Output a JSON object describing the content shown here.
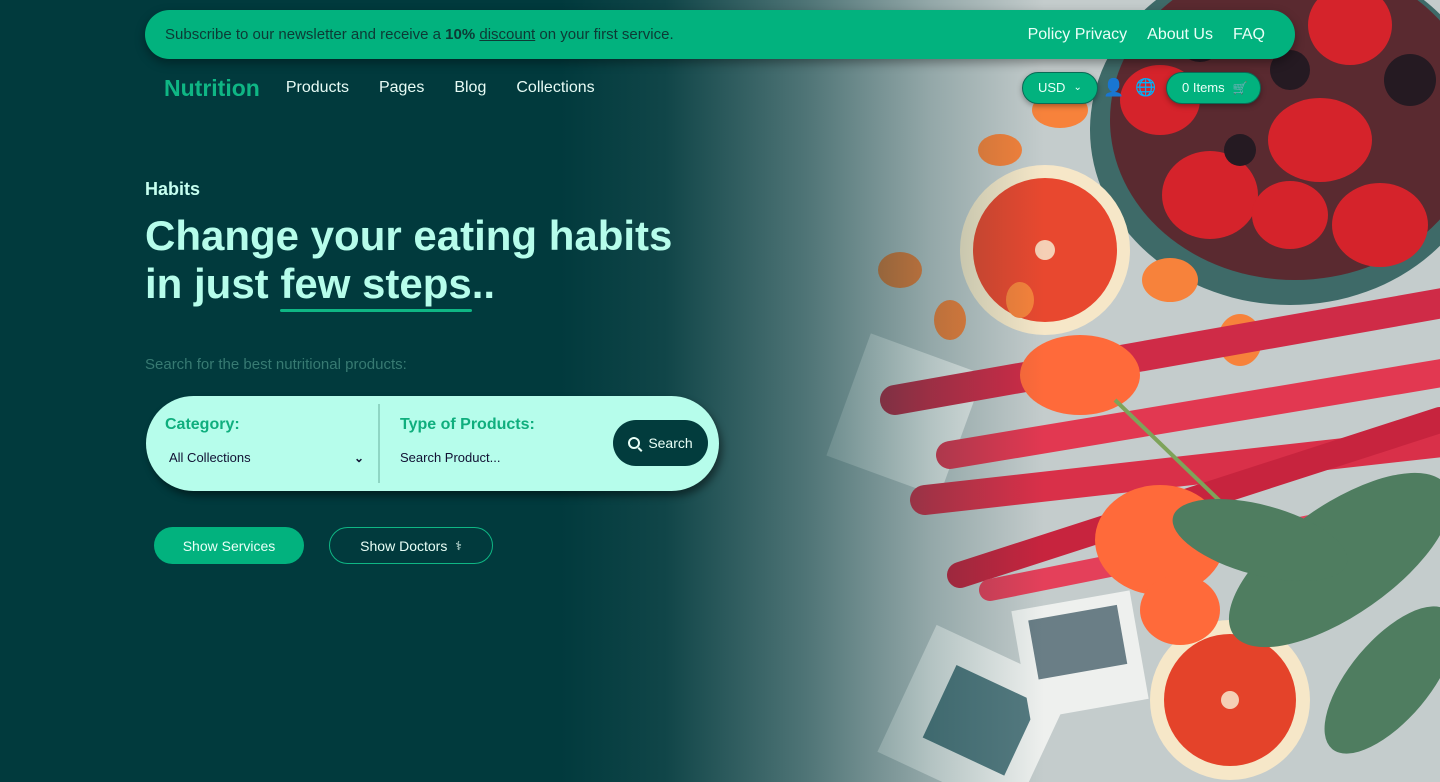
{
  "topbar": {
    "promo_pre": "Subscribe to our newsletter and receive a ",
    "promo_bold": "10%",
    "promo_link": "discount",
    "promo_post": " on your first service.",
    "links": [
      "Policy Privacy",
      "About Us",
      "FAQ"
    ]
  },
  "nav": {
    "logo": "Nutrition",
    "items": [
      "Products",
      "Pages",
      "Blog",
      "Collections"
    ],
    "currency": "USD",
    "cart_label": "0 Items"
  },
  "hero": {
    "eyebrow": "Habits",
    "headline_line1": "Change your eating habits",
    "headline_pre": "in just ",
    "headline_highlight": "few steps",
    "headline_post": "..",
    "subtitle": "Search for the best nutritional products:"
  },
  "search": {
    "category_label": "Category:",
    "category_value": "All Collections",
    "type_label": "Type of Products:",
    "type_placeholder": "Search Product...",
    "button_label": "Search"
  },
  "cta": {
    "services_label": "Show Services",
    "doctors_label": "Show Doctors"
  },
  "icons": {
    "user": "user-icon",
    "globe": "globe-icon",
    "cart": "cart-icon",
    "search": "search-icon",
    "doctor": "doctor-icon"
  },
  "colors": {
    "background": "#013a3d",
    "accent": "#02b27e",
    "light_mint": "#b6fdeb"
  }
}
